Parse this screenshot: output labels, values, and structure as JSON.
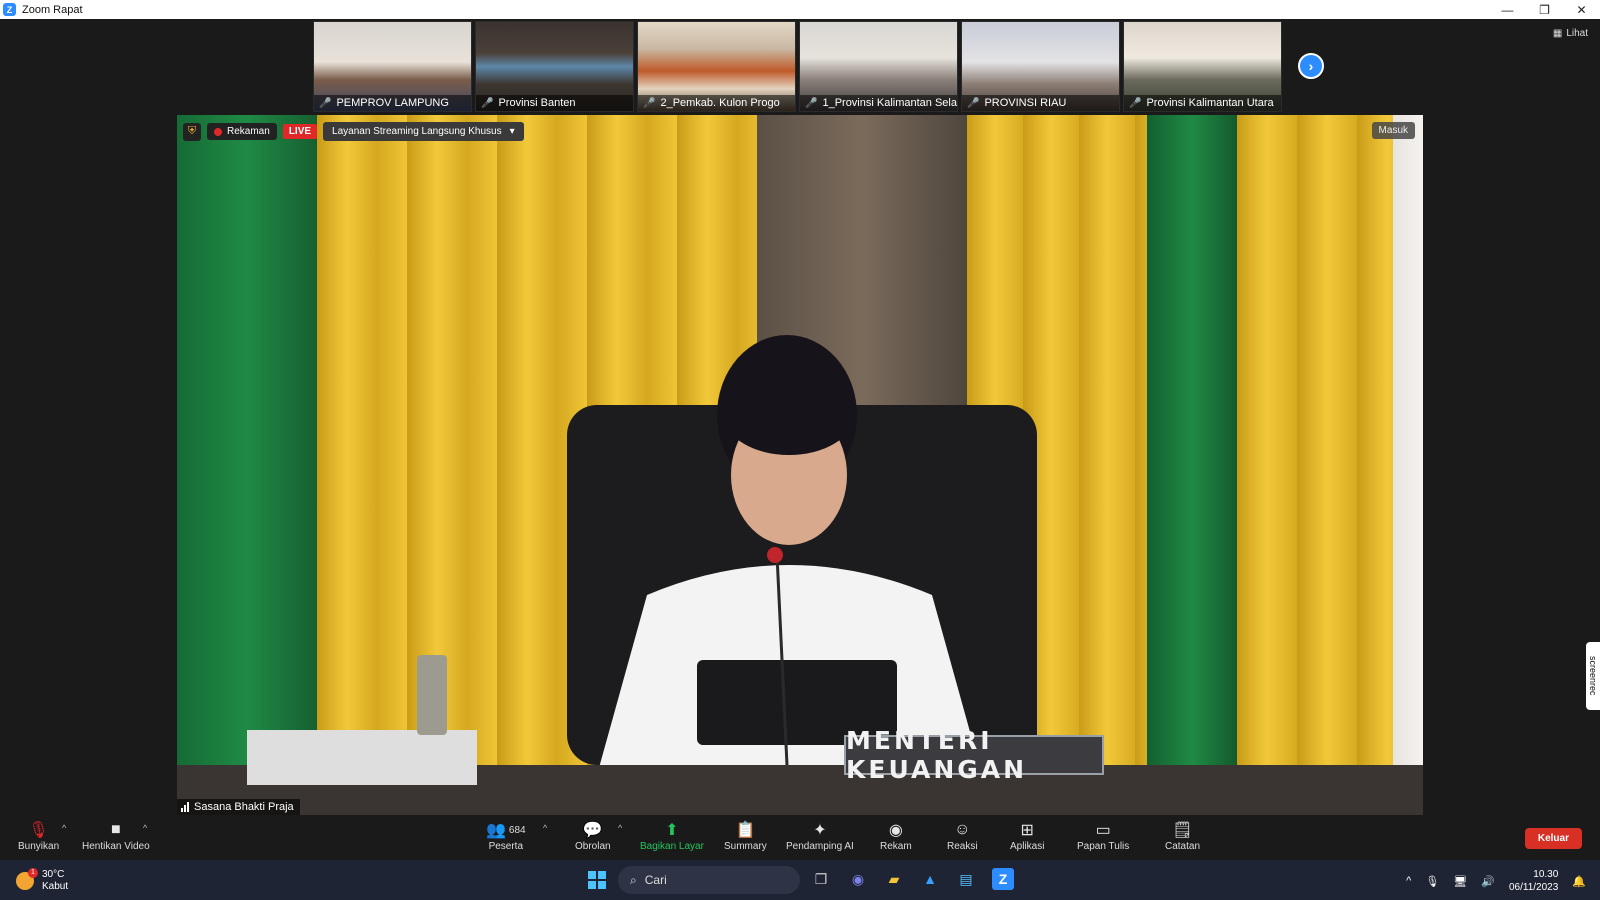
{
  "window": {
    "title": "Zoom Rapat",
    "controls": [
      "—",
      "❐",
      "✕"
    ]
  },
  "gallery": {
    "view_label": "Lihat",
    "thumbs": [
      {
        "label": "PEMPROV LAMPUNG"
      },
      {
        "label": "Provinsi Banten"
      },
      {
        "label": "2_Pemkab. Kulon Progo"
      },
      {
        "label": "1_Provinsi Kalimantan Selat..."
      },
      {
        "label": "PROVINSI RIAU"
      },
      {
        "label": "Provinsi Kalimantan Utara"
      }
    ]
  },
  "main_video": {
    "recording_label": "Rekaman",
    "live_label": "LIVE",
    "stream_dropdown": "Layanan Streaming Langsung Khusus",
    "join_label": "Masuk",
    "speaker_name": "Sasana Bhakti Praja",
    "nameplate": "MENTERI KEUANGAN",
    "side_tab": "screenrec"
  },
  "toolbar": {
    "unmute": "Bunyikan",
    "stop_video": "Hentikan Video",
    "participants": "Peserta",
    "participants_count": "684",
    "chat": "Obrolan",
    "share": "Bagikan Layar",
    "summary": "Summary",
    "ai": "Pendamping AI",
    "record": "Rekam",
    "reactions": "Reaksi",
    "apps": "Aplikasi",
    "whiteboard": "Papan Tulis",
    "notes": "Catatan",
    "leave": "Keluar"
  },
  "taskbar": {
    "temp": "30°C",
    "weather": "Kabut",
    "weather_badge": "1",
    "search_placeholder": "Cari",
    "time": "10.30",
    "date": "06/11/2023"
  },
  "colors": {
    "accent": "#2d8cff",
    "share_green": "#22c55e",
    "leave_red": "#d93025",
    "live_red": "#e02828",
    "curtain_gold": "#e2b42a",
    "curtain_green": "#1f7a3f"
  }
}
